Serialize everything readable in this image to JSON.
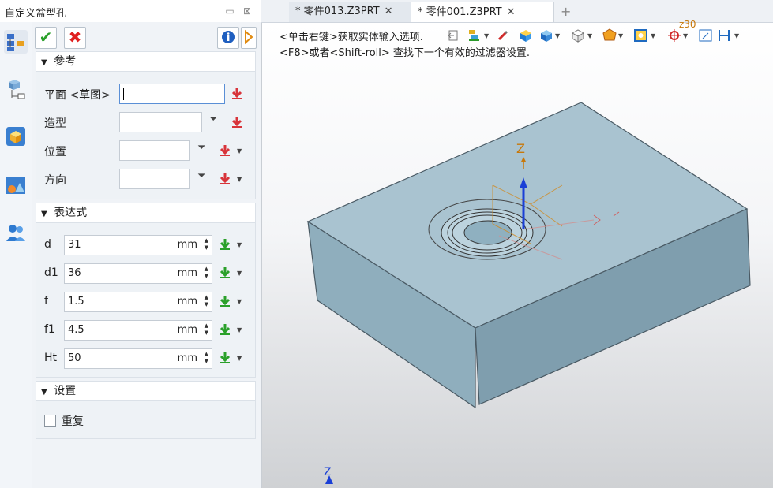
{
  "panel": {
    "title": "自定义盆型孔",
    "sections": {
      "reference": "参考",
      "expression": "表达式",
      "settings": "设置"
    },
    "reference_fields": [
      {
        "label": "平面 <草图>"
      },
      {
        "label": "造型"
      },
      {
        "label": "位置"
      },
      {
        "label": "方向"
      }
    ],
    "expression_fields": [
      {
        "label": "d",
        "value": "31",
        "unit": "mm"
      },
      {
        "label": "d1",
        "value": "36",
        "unit": "mm"
      },
      {
        "label": "f",
        "value": "1.5",
        "unit": "mm"
      },
      {
        "label": "f1",
        "value": "4.5",
        "unit": "mm"
      },
      {
        "label": "Ht",
        "value": "50",
        "unit": "mm"
      }
    ],
    "repeat_label": "重复",
    "repeat_checked": false
  },
  "tabs": [
    {
      "label": "* 零件013.Z3PRT",
      "close": "✕"
    },
    {
      "label": "* 零件001.Z3PRT",
      "close": "✕"
    }
  ],
  "tab_add": "+",
  "viewport": {
    "hint_line1": "<单击右键>获取实体输入选项.",
    "hint_line2": "<F8>或者<Shift-roll> 查找下一个有效的过滤器设置.",
    "axis_label": "Z",
    "axis_label_bottom": "Z",
    "corner_text": "z30"
  },
  "colors": {
    "accent": "#5a8fd6",
    "part_top": "#a9c3d0",
    "part_side": "#8faebd",
    "part_front": "#7f9eae",
    "axis_blue": "#1a3fd6",
    "axis_orange": "#c8780a"
  },
  "icons": [
    "ok-check-icon",
    "cancel-x-icon",
    "info-icon",
    "expand-right-icon",
    "download-arrow-icon",
    "chevron-double-down-icon"
  ]
}
